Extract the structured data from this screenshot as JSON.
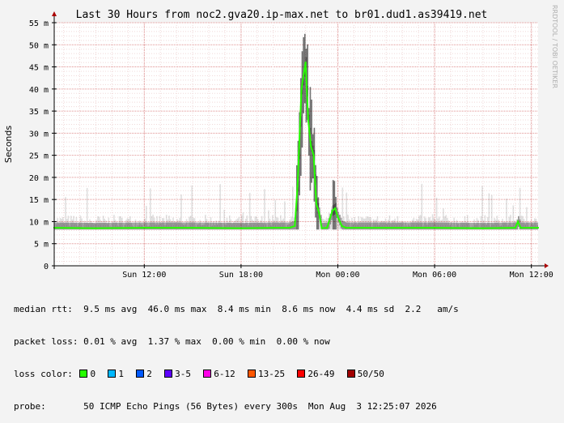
{
  "chart_data": {
    "type": "area",
    "title": "Last 30 Hours from noc2.gva20.ip-max.net to br01.dud1.as39419.net",
    "ylabel": "Seconds",
    "watermark": "RRDTOOL / TOBI OETIKER",
    "ylim_ms": [
      0,
      55
    ],
    "y_ticks": [
      "0",
      "5 m",
      "10 m",
      "15 m",
      "20 m",
      "25 m",
      "30 m",
      "35 m",
      "40 m",
      "45 m",
      "50 m",
      "55 m"
    ],
    "y_tick_values_ms": [
      0,
      5,
      10,
      15,
      20,
      25,
      30,
      35,
      40,
      45,
      50,
      55
    ],
    "x_range": [
      "Sun Aug 2 06:25",
      "Mon Aug 3 12:25"
    ],
    "x_ticks": [
      {
        "label": "Sun 12:00",
        "time": "Sun Aug 2 12:00"
      },
      {
        "label": "Sun 18:00",
        "time": "Sun Aug 2 18:00"
      },
      {
        "label": "Mon 00:00",
        "time": "Mon Aug 3 00:00"
      },
      {
        "label": "Mon 06:00",
        "time": "Mon Aug 3 06:00"
      },
      {
        "label": "Mon 12:00",
        "time": "Mon Aug 3 12:00"
      }
    ],
    "median_rtt_ms": {
      "times": [
        "Sun Aug 2 06:25",
        "Sun Aug 2 09:00",
        "Sun Aug 2 12:00",
        "Sun Aug 2 15:00",
        "Sun Aug 2 18:00",
        "Sun Aug 2 20:00",
        "Sun Aug 2 21:00",
        "Sun Aug 2 21:20",
        "Sun Aug 2 21:30",
        "Sun Aug 2 21:45",
        "Sun Aug 2 22:00",
        "Sun Aug 2 22:10",
        "Sun Aug 2 22:20",
        "Sun Aug 2 22:30",
        "Sun Aug 2 22:40",
        "Sun Aug 2 22:50",
        "Sun Aug 2 23:00",
        "Sun Aug 2 23:20",
        "Sun Aug 2 23:40",
        "Sun Aug 2 23:50",
        "Mon Aug 3 00:00",
        "Mon Aug 3 00:15",
        "Mon Aug 3 00:30",
        "Mon Aug 3 03:00",
        "Mon Aug 3 06:00",
        "Mon Aug 3 09:00",
        "Mon Aug 3 11:00",
        "Mon Aug 3 11:10",
        "Mon Aug 3 11:20",
        "Mon Aug 3 12:25"
      ],
      "values": [
        8.6,
        8.5,
        8.6,
        8.6,
        8.5,
        8.6,
        8.6,
        9,
        18,
        40,
        46,
        33,
        27,
        25,
        14,
        12,
        8.5,
        8.6,
        12.5,
        13,
        11,
        9,
        8.6,
        8.6,
        8.6,
        8.5,
        8.6,
        10,
        8.6,
        8.6
      ]
    },
    "stats": {
      "median_rtt": {
        "label": "median rtt:",
        "avg": "9.5 ms avg",
        "max": "46.0 ms max",
        "min": "8.4 ms min",
        "now": "8.6 ms now",
        "sd": "4.4 ms sd",
        "amps": "2.2",
        "amps_unit": "am/s"
      },
      "packet_loss": {
        "label": "packet loss:",
        "avg": "0.01 % avg",
        "max": "1.37 % max",
        "min": "0.00 % min",
        "now": "0.00 % now"
      }
    },
    "loss_color": {
      "label": "loss color:",
      "items": [
        {
          "label": "0",
          "color": "#26ff00"
        },
        {
          "label": "1",
          "color": "#00b8ff"
        },
        {
          "label": "2",
          "color": "#0059ff"
        },
        {
          "label": "3-5",
          "color": "#5e00ff"
        },
        {
          "label": "6-12",
          "color": "#ff00e8"
        },
        {
          "label": "13-25",
          "color": "#ff5700"
        },
        {
          "label": "26-49",
          "color": "#ff0000"
        },
        {
          "label": "50/50",
          "color": "#a10000"
        }
      ]
    },
    "probe": {
      "label": "probe:",
      "text": "50 ICMP Echo Pings (56 Bytes) every 300s",
      "date": "Mon Aug  3 12:25:07 2026"
    },
    "colors": {
      "background": "#f3f3f3",
      "plot": "#ffffff",
      "grid": "#e09090",
      "median": "#26ff00",
      "smoke": "#000000"
    }
  }
}
